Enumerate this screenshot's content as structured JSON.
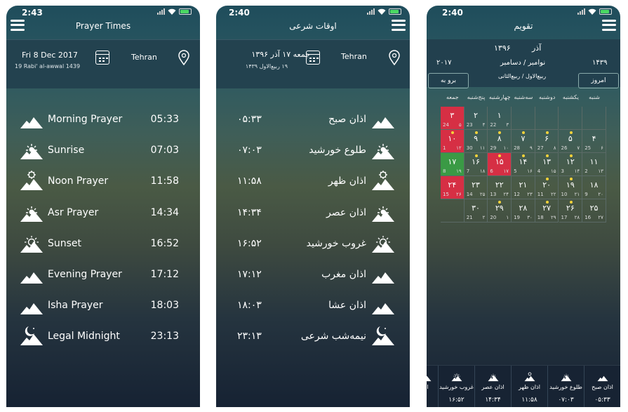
{
  "screen1": {
    "time": "2:43",
    "title": "Prayer Times",
    "date_line1": "Fri  8  Dec  2017",
    "date_line2": "19  Rabi' al-awwal  1439",
    "city": "Tehran",
    "prayers": [
      {
        "icon": "mountain-icon",
        "name": "Morning Prayer",
        "time": "05:33"
      },
      {
        "icon": "sunrise-icon",
        "name": "Sunrise",
        "time": "07:03"
      },
      {
        "icon": "noon-sun-icon",
        "name": "Noon Prayer",
        "time": "11:58"
      },
      {
        "icon": "sunrise-icon",
        "name": "Asr Prayer",
        "time": "14:34"
      },
      {
        "icon": "sunset-icon",
        "name": "Sunset",
        "time": "16:52"
      },
      {
        "icon": "mountain-icon",
        "name": "Evening Prayer",
        "time": "17:12"
      },
      {
        "icon": "mountain-icon",
        "name": "Isha Prayer",
        "time": "18:03"
      },
      {
        "icon": "moon-icon",
        "name": "Legal Midnight",
        "time": "23:13"
      }
    ]
  },
  "screen2": {
    "time": "2:40",
    "title": "اوقات شرعی",
    "date_line1": "جمعه ۱۷ آذر ۱۳۹۶",
    "date_line2": "۱۹ ربیع‌الاول ۱۴۳۹",
    "city": "Tehran",
    "prayers": [
      {
        "icon": "mountain-icon",
        "name": "اذان صبح",
        "time": "۰۵:۳۳"
      },
      {
        "icon": "sunrise-icon",
        "name": "طلوع خورشید",
        "time": "۰۷:۰۳"
      },
      {
        "icon": "noon-sun-icon",
        "name": "اذان ظهر",
        "time": "۱۱:۵۸"
      },
      {
        "icon": "sunrise-icon",
        "name": "اذان عصر",
        "time": "۱۴:۳۴"
      },
      {
        "icon": "sunset-icon",
        "name": "غروب خورشید",
        "time": "۱۶:۵۲"
      },
      {
        "icon": "mountain-icon",
        "name": "اذان مغرب",
        "time": "۱۷:۱۲"
      },
      {
        "icon": "mountain-icon",
        "name": "اذان عشا",
        "time": "۱۸:۰۳"
      },
      {
        "icon": "moon-icon",
        "name": "نیمه‌شب شرعی",
        "time": "۲۳:۱۳"
      }
    ]
  },
  "screen3": {
    "time": "2:40",
    "title": "تقویم",
    "persian_month": "آذر",
    "persian_year": "۱۳۹۶",
    "greg_months": "نوامبر / دسامبر",
    "greg_year": "۲۰۱۷",
    "hijri_months": "ربیع‌الاول / ربیع‌الثانی",
    "hijri_year": "۱۴۳۹",
    "today_button": "امروز",
    "goto_button": "برو به",
    "weekdays": [
      "شنبه",
      "یکشنبه",
      "دوشنبه",
      "سه‌شنبه",
      "چهارشنبه",
      "پنج‌شنبه",
      "جمعه"
    ],
    "rows": [
      [
        {
          "d": "",
          "g": "",
          "h": ""
        },
        {
          "d": "",
          "g": "",
          "h": ""
        },
        {
          "d": "",
          "g": "",
          "h": ""
        },
        {
          "d": "",
          "g": "",
          "h": ""
        },
        {
          "d": "۱",
          "g": "22",
          "h": "۳"
        },
        {
          "d": "۲",
          "g": "23",
          "h": "۴"
        },
        {
          "d": "۳",
          "g": "24",
          "h": "۵",
          "s": "red"
        }
      ],
      [
        {
          "d": "۴",
          "g": "25",
          "h": "۶"
        },
        {
          "d": "۵",
          "g": "26",
          "h": "۷",
          "dot": true
        },
        {
          "d": "۶",
          "g": "27",
          "h": "۸",
          "dot": true
        },
        {
          "d": "۷",
          "g": "28",
          "h": "۹",
          "dot": true
        },
        {
          "d": "۸",
          "g": "29",
          "h": "۱۰",
          "dot": true
        },
        {
          "d": "۹",
          "g": "30",
          "h": "۱۱",
          "dot": true
        },
        {
          "d": "۱۰",
          "g": "1",
          "h": "۱۲",
          "s": "red",
          "dot": true
        }
      ],
      [
        {
          "d": "۱۱",
          "g": "2",
          "h": "۱۳"
        },
        {
          "d": "۱۲",
          "g": "3",
          "h": "۱۴",
          "dot": true
        },
        {
          "d": "۱۳",
          "g": "4",
          "h": "۱۵",
          "dot": true
        },
        {
          "d": "۱۴",
          "g": "5",
          "h": "۱۶",
          "dot": true
        },
        {
          "d": "۱۵",
          "g": "6",
          "h": "۱۷",
          "s": "red",
          "dot": true
        },
        {
          "d": "۱۶",
          "g": "7",
          "h": "۱۸",
          "dot": true
        },
        {
          "d": "۱۷",
          "g": "8",
          "h": "۱۹",
          "s": "green"
        }
      ],
      [
        {
          "d": "۱۸",
          "g": "9",
          "h": "۲۰"
        },
        {
          "d": "۱۹",
          "g": "10",
          "h": "۲۱",
          "dot": true
        },
        {
          "d": "۲۰",
          "g": "11",
          "h": "۲۲",
          "dot": true
        },
        {
          "d": "۲۱",
          "g": "12",
          "h": "۲۳"
        },
        {
          "d": "۲۲",
          "g": "13",
          "h": "۲۴"
        },
        {
          "d": "۲۳",
          "g": "14",
          "h": "۲۵"
        },
        {
          "d": "۲۴",
          "g": "15",
          "h": "۲۶",
          "s": "red"
        }
      ],
      [
        {
          "d": "۲۵",
          "g": "16",
          "h": "۲۷"
        },
        {
          "d": "۲۶",
          "g": "17",
          "h": "۲۸",
          "dot": true
        },
        {
          "d": "۲۷",
          "g": "18",
          "h": "۲۹",
          "dot": true
        },
        {
          "d": "۲۸",
          "g": "19",
          "h": "۳۰"
        },
        {
          "d": "۲۹",
          "g": "20",
          "h": "۱",
          "dot": true
        },
        {
          "d": "۳۰",
          "g": "21",
          "h": "۲"
        },
        {
          "d": "",
          "g": "",
          "h": ""
        }
      ]
    ],
    "bottom_bar": [
      {
        "icon": "mountain-icon",
        "name": "اذان صبح",
        "time": "۰۵:۳۳"
      },
      {
        "icon": "sunrise-icon",
        "name": "طلوع خورشید",
        "time": "۰۷:۰۳"
      },
      {
        "icon": "noon-sun-icon",
        "name": "اذان ظهر",
        "time": "۱۱:۵۸"
      },
      {
        "icon": "sunrise-icon",
        "name": "اذان عصر",
        "time": "۱۴:۳۴"
      },
      {
        "icon": "sunset-icon",
        "name": "غروب خورشید",
        "time": "۱۶:۵۲"
      },
      {
        "icon": "mountain-icon",
        "name": "اذا",
        "time": ""
      }
    ]
  },
  "colors": {
    "holiday": "#d62f44",
    "today": "#3a9a45",
    "event_dot": "#f5d33a",
    "header": "#23424f"
  }
}
